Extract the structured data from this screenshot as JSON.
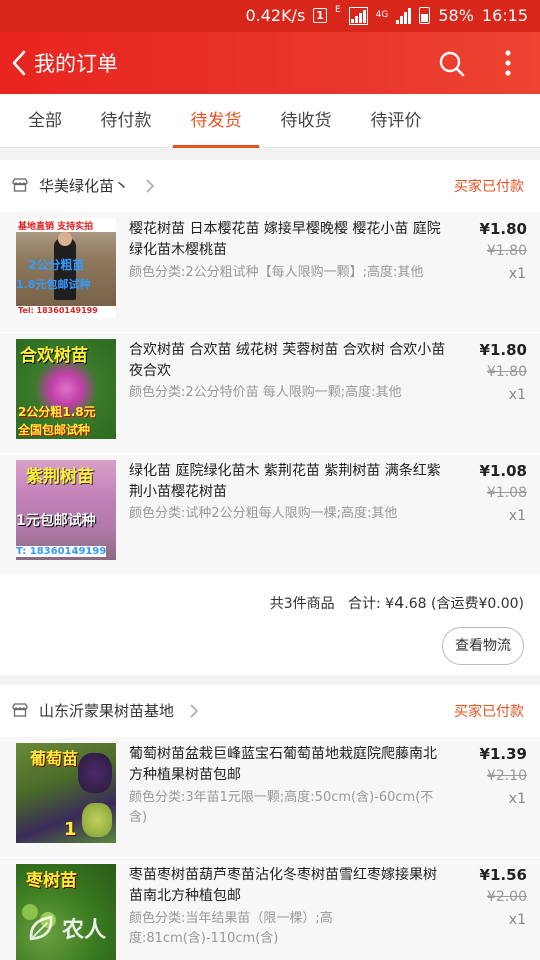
{
  "status_bar": {
    "speed": "0.42K/s",
    "sim_badge": "1",
    "network_small": "E",
    "network_4g_a": "4G",
    "network_4g_b": "4G",
    "battery": "58%",
    "time": "16:15"
  },
  "header": {
    "title": "我的订单",
    "back_icon": "chevron-left-icon",
    "search_icon": "search-icon",
    "more_icon": "more-vertical-icon"
  },
  "tabs": [
    {
      "label": "全部",
      "active": false
    },
    {
      "label": "待付款",
      "active": false
    },
    {
      "label": "待发货",
      "active": true
    },
    {
      "label": "待收货",
      "active": false
    },
    {
      "label": "待评价",
      "active": false
    }
  ],
  "orders": [
    {
      "shop_name": "华美绿化苗丶",
      "status": "买家已付款",
      "items": [
        {
          "title": "樱花树苗 日本樱花苗 嫁接早樱晚樱 樱花小苗 庭院绿化苗木樱桃苗",
          "spec": "颜色分类:2公分粗试种【每人限购一颗】;高度:其他",
          "price": "¥1.80",
          "original_price": "¥1.80",
          "quantity": "x1",
          "thumb_caption_top": "基地直销  支持实拍",
          "thumb_caption_mid": "2公分粗苗",
          "thumb_caption_low": "1.8元包邮试种",
          "thumb_caption_bottom": "Tel: 18360149199"
        },
        {
          "title": "合欢树苗 合欢苗 绒花树 芙蓉树苗 合欢树 合欢小苗 夜合欢",
          "spec": "颜色分类:2公分特价苗  每人限购一颗;高度:其他",
          "price": "¥1.80",
          "original_price": "¥1.80",
          "quantity": "x1",
          "thumb_caption_top": "合欢树苗",
          "thumb_caption_mid": "2公分粗1.8元",
          "thumb_caption_low": "全国包邮试种"
        },
        {
          "title": "绿化苗 庭院绿化苗木 紫荆花苗 紫荆树苗 满条红紫荆小苗樱花树苗",
          "spec": "颜色分类:试种2公分粗每人限购一棵;高度:其他",
          "price": "¥1.08",
          "original_price": "¥1.08",
          "quantity": "x1",
          "thumb_caption_top": "紫荆树苗",
          "thumb_caption_low": "1元包邮试种",
          "thumb_caption_bottom": "T: 18360149199"
        }
      ],
      "summary": {
        "count_text": "共3件商品",
        "total_label": "合计:",
        "currency": "¥",
        "total_int": "4",
        "total_dec": ".68",
        "shipping_text": "(含运费¥0.00)"
      },
      "action_label": "查看物流"
    },
    {
      "shop_name": "山东沂蒙果树苗基地",
      "status": "买家已付款",
      "items": [
        {
          "title": "葡萄树苗盆栽巨峰蓝宝石葡萄苗地栽庭院爬藤南北方种植果树苗包邮",
          "spec": "颜色分类:3年苗1元限一颗;高度:50cm(含)-60cm(不含)",
          "price": "¥1.39",
          "original_price": "¥2.10",
          "quantity": "x1",
          "thumb_caption_top": "葡萄苗",
          "thumb_caption_bottom": "1"
        },
        {
          "title": "枣苗枣树苗葫芦枣苗沾化冬枣树苗雪红枣嫁接果树苗南北方种植包邮",
          "spec": "颜色分类:当年结果苗（限一棵）;高度:81cm(含)-110cm(含)",
          "price": "¥1.56",
          "original_price": "¥2.00",
          "quantity": "x1",
          "thumb_caption_top": "枣树苗"
        }
      ]
    }
  ],
  "watermark": {
    "text": "农人",
    "icon": "leaf-logo-icon"
  }
}
